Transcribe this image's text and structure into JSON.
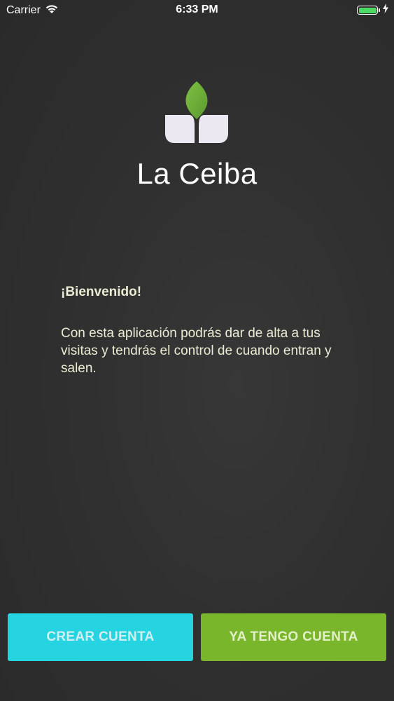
{
  "status_bar": {
    "carrier": "Carrier",
    "time": "6:33 PM",
    "wifi_icon": "wifi-icon",
    "battery_icon": "battery-icon",
    "charging_icon": "charging-bolt-icon",
    "battery_level": 1.0,
    "battery_color": "#4cd964"
  },
  "brand": {
    "app_name": "La Ceiba",
    "logo_icon": "ceiba-leaf-logo",
    "leaf_color": "#6ea838",
    "petal_color": "#ebe8f1"
  },
  "welcome": {
    "title": "¡Bienvenido!",
    "body": "Con esta aplicación podrás dar de alta a tus visitas y tendrás el control de cuando entran y salen.",
    "text_color": "#ecebd3"
  },
  "actions": {
    "create_account": "CREAR CUENTA",
    "have_account": "YA TENGO CUENTA",
    "create_color": "#26d3e0",
    "login_color": "#7ab62b"
  }
}
